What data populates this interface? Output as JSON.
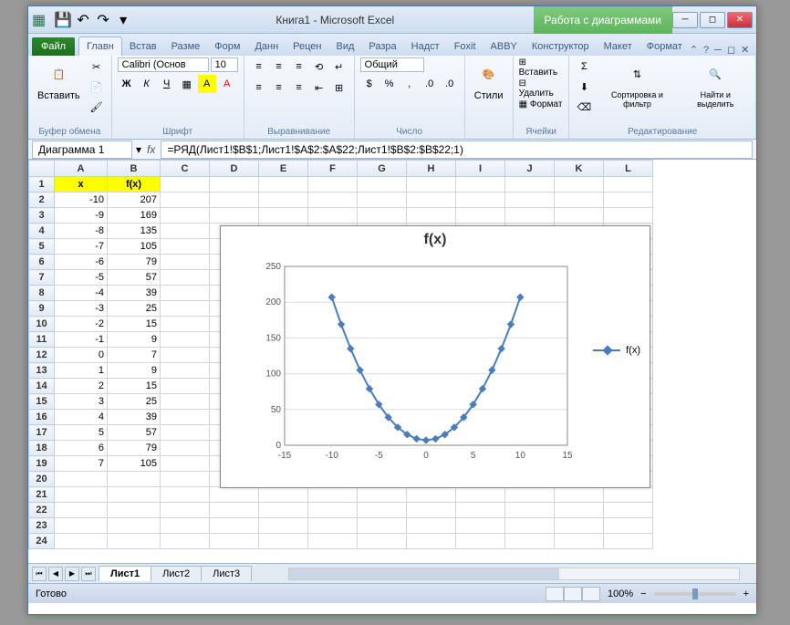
{
  "title": {
    "doc": "Книга1",
    "app": "Microsoft Excel",
    "context": "Работа с диаграммами"
  },
  "qat": {
    "save": "💾",
    "undo": "↶",
    "redo": "↷"
  },
  "tabs": {
    "file": "Файл",
    "items": [
      "Главн",
      "Встав",
      "Разме",
      "Форм",
      "Данн",
      "Рецен",
      "Вид",
      "Разра",
      "Надст",
      "Foxit",
      "ABBY"
    ],
    "chart_items": [
      "Конструктор",
      "Макет",
      "Формат"
    ],
    "active": "Главн"
  },
  "ribbon": {
    "clipboard": {
      "label": "Буфер обмена",
      "paste": "Вставить"
    },
    "font": {
      "label": "Шрифт",
      "name": "Calibri (Основ",
      "size": "10"
    },
    "align": {
      "label": "Выравнивание"
    },
    "number": {
      "label": "Число",
      "format": "Общий"
    },
    "styles": {
      "label": "Стили",
      "btn": "Стили"
    },
    "cells": {
      "label": "Ячейки",
      "insert": "Вставить",
      "delete": "Удалить",
      "format": "Формат"
    },
    "editing": {
      "label": "Редактирование",
      "sort": "Сортировка и фильтр",
      "find": "Найти и выделить"
    }
  },
  "formula_bar": {
    "name_box": "Диаграмма 1",
    "formula": "=РЯД(Лист1!$B$1;Лист1!$A$2:$A$22;Лист1!$B$2:$B$22;1)"
  },
  "sheet": {
    "columns": [
      "A",
      "B",
      "C",
      "D",
      "E",
      "F",
      "G",
      "H",
      "I",
      "J",
      "K",
      "L"
    ],
    "headers": {
      "A": "x",
      "B": "f(x)"
    },
    "rows": [
      {
        "n": 2,
        "x": -10,
        "fx": 207
      },
      {
        "n": 3,
        "x": -9,
        "fx": 169
      },
      {
        "n": 4,
        "x": -8,
        "fx": 135
      },
      {
        "n": 5,
        "x": -7,
        "fx": 105
      },
      {
        "n": 6,
        "x": -6,
        "fx": 79
      },
      {
        "n": 7,
        "x": -5,
        "fx": 57
      },
      {
        "n": 8,
        "x": -4,
        "fx": 39
      },
      {
        "n": 9,
        "x": -3,
        "fx": 25
      },
      {
        "n": 10,
        "x": -2,
        "fx": 15
      },
      {
        "n": 11,
        "x": -1,
        "fx": 9
      },
      {
        "n": 12,
        "x": 0,
        "fx": 7
      },
      {
        "n": 13,
        "x": 1,
        "fx": 9
      },
      {
        "n": 14,
        "x": 2,
        "fx": 15
      },
      {
        "n": 15,
        "x": 3,
        "fx": 25
      },
      {
        "n": 16,
        "x": 4,
        "fx": 39
      },
      {
        "n": 17,
        "x": 5,
        "fx": 57
      },
      {
        "n": 18,
        "x": 6,
        "fx": 79
      },
      {
        "n": 19,
        "x": 7,
        "fx": 105
      }
    ]
  },
  "sheet_tabs": {
    "items": [
      "Лист1",
      "Лист2",
      "Лист3"
    ],
    "active": "Лист1"
  },
  "statusbar": {
    "ready": "Готово",
    "zoom": "100%",
    "minus": "−",
    "plus": "+"
  },
  "chart_data": {
    "type": "line",
    "title": "f(x)",
    "legend": "f(x)",
    "xlim": [
      -15,
      15
    ],
    "ylim": [
      0,
      250
    ],
    "xticks": [
      -15,
      -10,
      -5,
      0,
      5,
      10,
      15
    ],
    "yticks": [
      0,
      50,
      100,
      150,
      200,
      250
    ],
    "x": [
      -10,
      -9,
      -8,
      -7,
      -6,
      -5,
      -4,
      -3,
      -2,
      -1,
      0,
      1,
      2,
      3,
      4,
      5,
      6,
      7,
      8,
      9,
      10
    ],
    "y": [
      207,
      169,
      135,
      105,
      79,
      57,
      39,
      25,
      15,
      9,
      7,
      9,
      15,
      25,
      39,
      57,
      79,
      105,
      135,
      169,
      207
    ]
  }
}
